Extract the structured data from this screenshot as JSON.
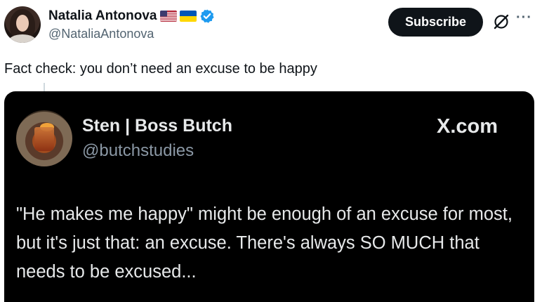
{
  "author": {
    "name": "Natalia Antonova",
    "handle": "@NataliaAntonova",
    "flags": [
      "us-flag-icon",
      "ukraine-flag-icon"
    ],
    "verified_color": "#1d9bf0"
  },
  "actions": {
    "subscribe_label": "Subscribe",
    "grok_icon": "grok-icon",
    "more_label": "···"
  },
  "tweet": {
    "text": "Fact check: you don’t need an excuse to be happy"
  },
  "quoted_card": {
    "name": "Sten | Boss Butch",
    "handle": "@butchstudies",
    "source": "X.com",
    "text": "\"He makes me happy\" might be enough of an excuse for most, but it's just that: an excuse. There's always SO MUCH that needs to be excused..."
  }
}
